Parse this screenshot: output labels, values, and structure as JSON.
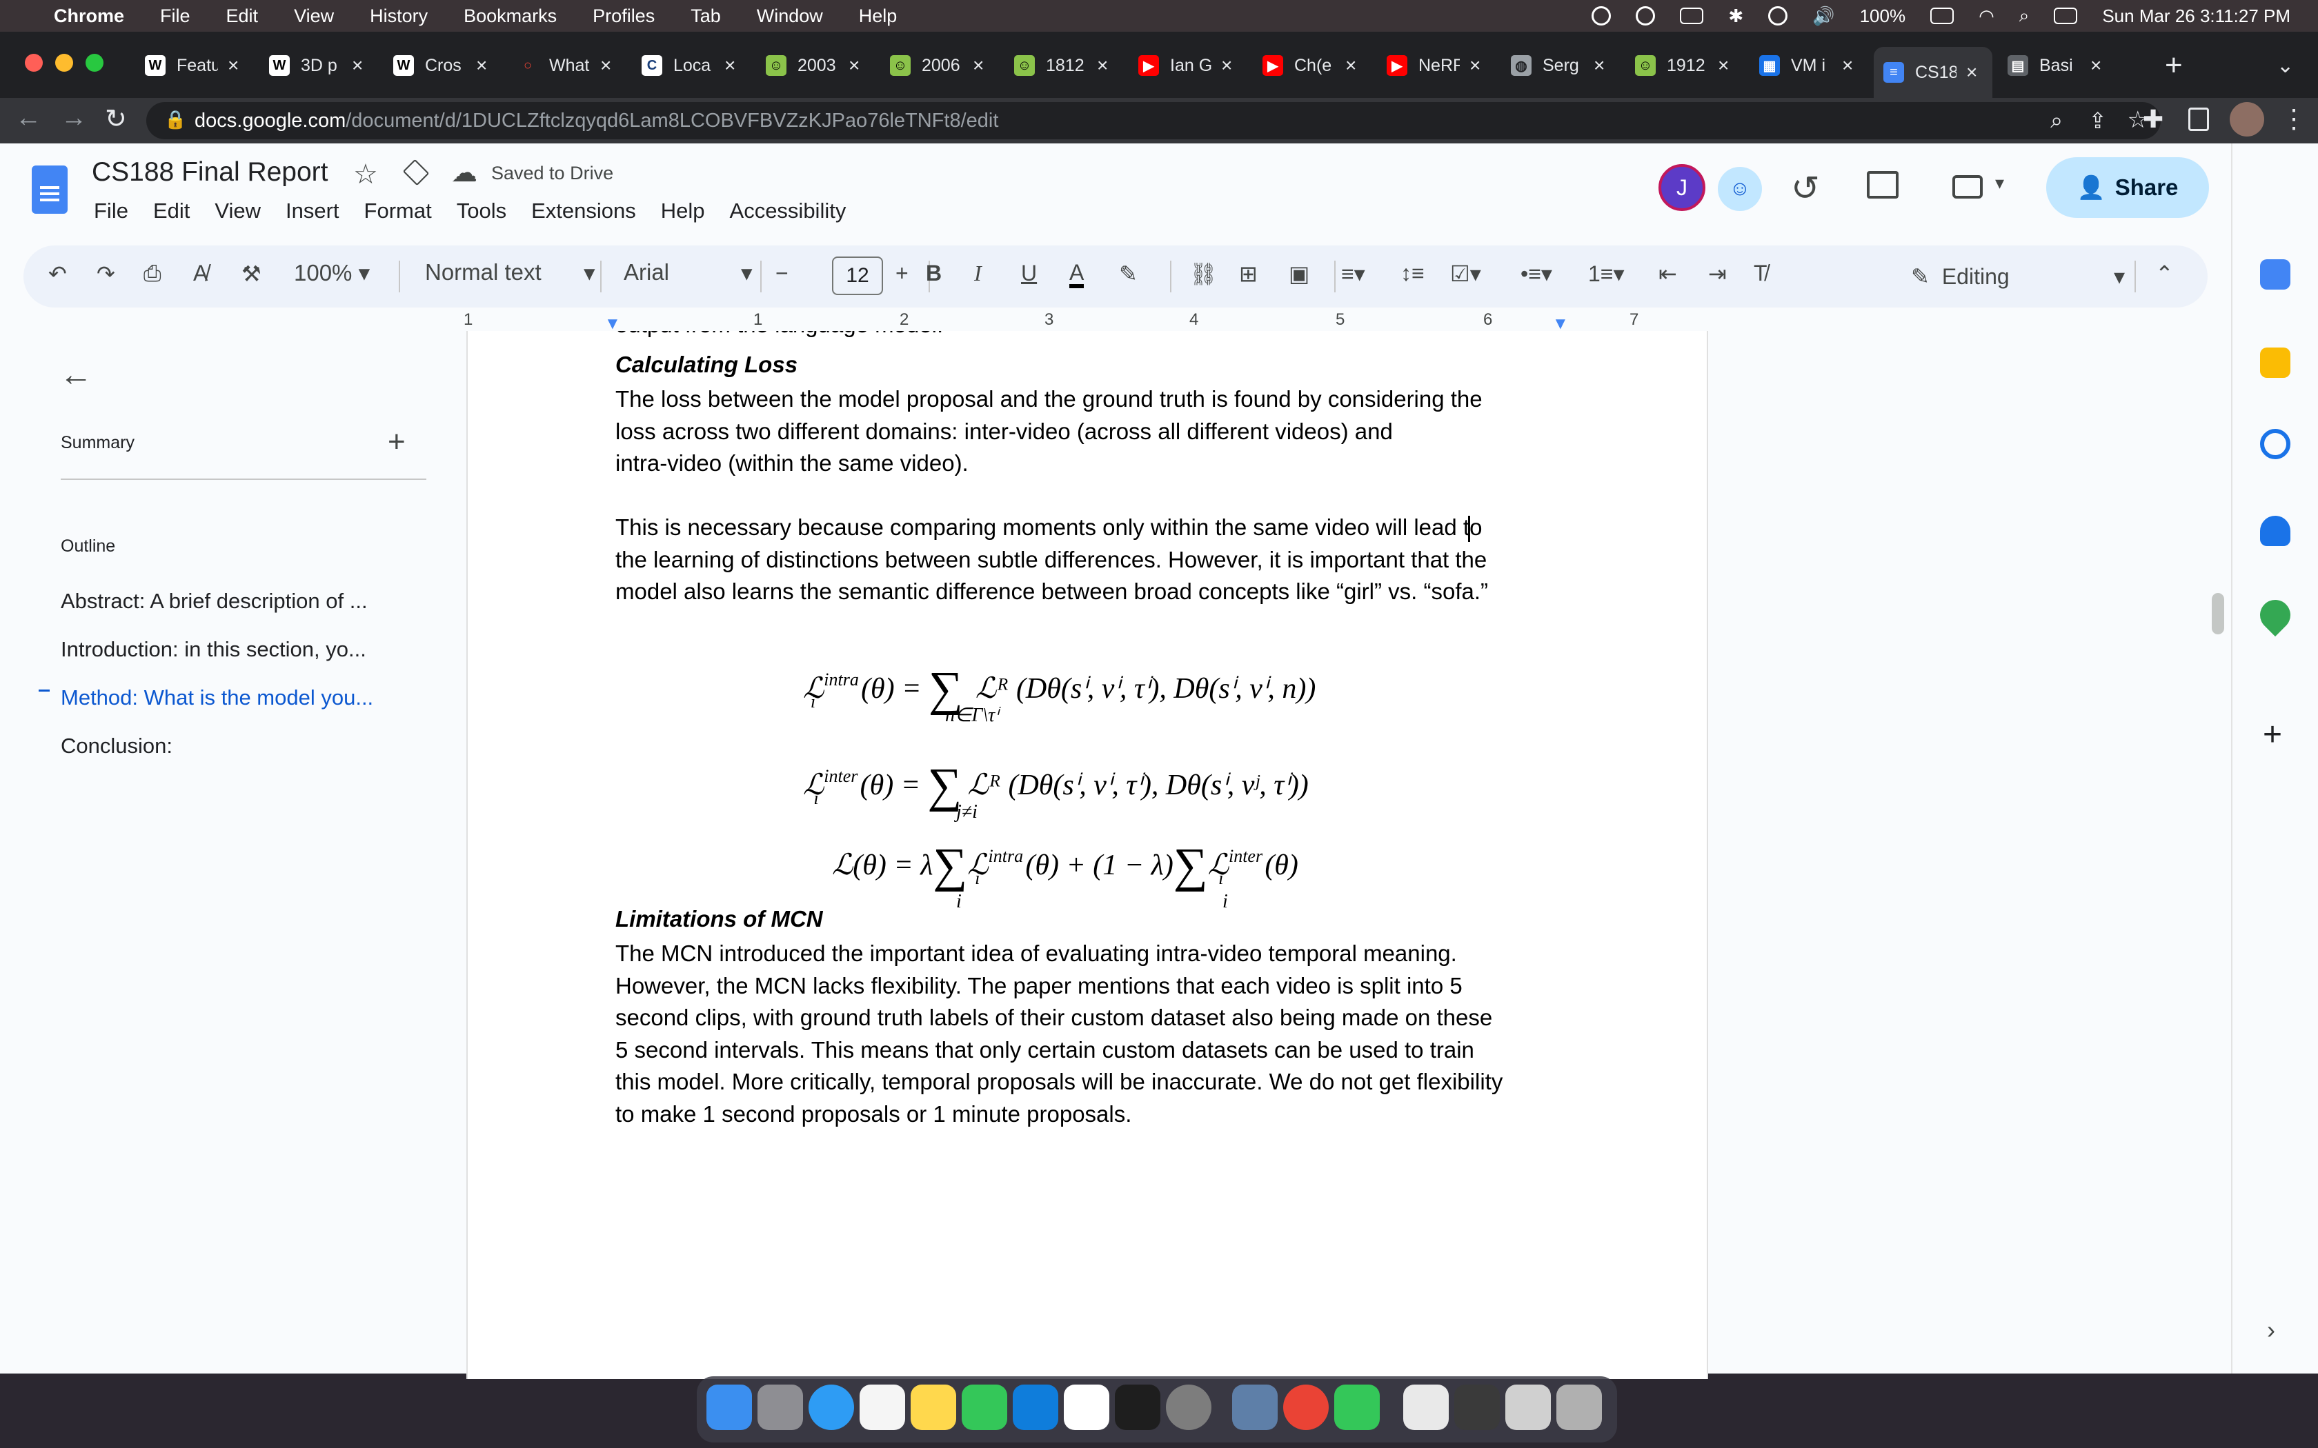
{
  "menubar": {
    "app": "Chrome",
    "items": [
      "File",
      "Edit",
      "View",
      "History",
      "Bookmarks",
      "Profiles",
      "Tab",
      "Window",
      "Help"
    ],
    "battery": "100%",
    "datetime": "Sun Mar 26  3:11:27 PM"
  },
  "tabs": [
    {
      "title": "Featu",
      "icon": "wikipedia-icon"
    },
    {
      "title": "3D p",
      "icon": "wikipedia-icon"
    },
    {
      "title": "Cros",
      "icon": "wikipedia-icon"
    },
    {
      "title": "What",
      "icon": "spinner-icon"
    },
    {
      "title": "Loca",
      "icon": "cvf-icon"
    },
    {
      "title": "2003",
      "icon": "smiley-icon"
    },
    {
      "title": "2006",
      "icon": "smiley-icon"
    },
    {
      "title": "1812",
      "icon": "smiley-icon"
    },
    {
      "title": "Ian G",
      "icon": "youtube-icon"
    },
    {
      "title": "Ch(e",
      "icon": "youtube-icon"
    },
    {
      "title": "NeRF",
      "icon": "youtube-icon"
    },
    {
      "title": "Serg",
      "icon": "globe-icon"
    },
    {
      "title": "1912",
      "icon": "smiley-icon"
    },
    {
      "title": "VM i",
      "icon": "chip-icon"
    },
    {
      "title": "CS18",
      "icon": "docs-icon",
      "active": true
    },
    {
      "title": "Basi",
      "icon": "generic-icon"
    }
  ],
  "address": {
    "host": "docs.google.com",
    "path": "/document/d/1DUCLZftclzqyqd6Lam8LCOBVFBVZzKJPao76leTNFt8/edit"
  },
  "docs": {
    "title": "CS188 Final Report",
    "saved_status": "Saved to Drive",
    "menu": [
      "File",
      "Edit",
      "View",
      "Insert",
      "Format",
      "Tools",
      "Extensions",
      "Help",
      "Accessibility"
    ],
    "share_label": "Share",
    "avatar_initial": "J",
    "mode_label": "Editing"
  },
  "format_toolbar": {
    "zoom": "100%",
    "style": "Normal text",
    "font": "Arial",
    "font_size": "12"
  },
  "ruler_numbers": [
    "1",
    "1",
    "2",
    "3",
    "4",
    "5",
    "6",
    "7"
  ],
  "outline": {
    "summary_label": "Summary",
    "outline_label": "Outline",
    "items": [
      {
        "label": "Abstract: A brief description of ...",
        "active": false
      },
      {
        "label": "Introduction: in this section, yo...",
        "active": false
      },
      {
        "label": "Method: What is the model you...",
        "active": true
      },
      {
        "label": "Conclusion:",
        "active": false
      }
    ]
  },
  "document": {
    "cutoff_line": "output from the language model.",
    "calc_heading": "Calculating Loss",
    "calc_lines": [
      "The loss between the model proposal and the ground truth is found by considering the",
      "loss across two different domains: inter-video (across all different videos) and",
      "intra-video (within the same video)."
    ],
    "necessary_lines": [
      "This is necessary because comparing moments only within the same video will lead to",
      "the learning of distinctions between subtle differences. However, it is important that the",
      "model also learns the semantic difference between broad concepts like “girl” vs. “sofa.”"
    ],
    "eq1": {
      "lhs": "ℒ",
      "sup": "intra",
      "sub": "i",
      "mid": "(θ) = ",
      "sum_under": "n∈Γ\\τⁱ",
      "rhs": "ℒᴿ (Dθ(sⁱ, vⁱ, τⁱ), Dθ(sⁱ, vⁱ, n))"
    },
    "eq2": {
      "lhs": "ℒ",
      "sup": "inter",
      "sub": "i",
      "mid": "(θ) = ",
      "sum_under": "j≠i",
      "rhs": "ℒᴿ (Dθ(sⁱ, vⁱ, τⁱ), Dθ(sⁱ, vʲ, τⁱ))"
    },
    "eq3": {
      "lhs": "ℒ(θ) = λ",
      "part1": "ℒ",
      "sup1": "intra",
      "sub1": "i",
      "mid1": "(θ) + (1 − λ)",
      "part2": "ℒ",
      "sup2": "inter",
      "sub2": "i",
      "end": "(θ)",
      "sum_under": "i"
    },
    "limits_heading": "Limitations of MCN",
    "limits_lines": [
      "The MCN introduced the important idea of evaluating intra-video temporal meaning.",
      "However, the MCN lacks flexibility. The paper mentions that each video is split into 5",
      "second clips, with ground truth labels of their custom dataset also being made on these",
      "5 second intervals. This means that only certain custom datasets can be used to train",
      "this model. More critically, temporal proposals will be inaccurate. We do not get flexibility",
      "to make 1 second proposals or 1 minute proposals."
    ]
  }
}
